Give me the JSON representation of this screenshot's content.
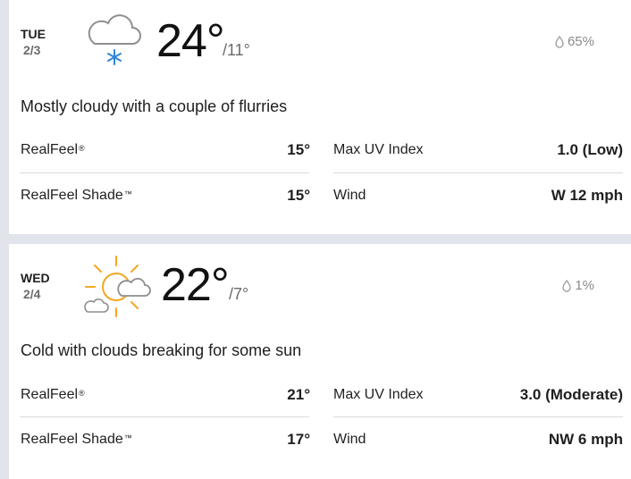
{
  "days": [
    {
      "day": "TUE",
      "date": "2/3",
      "icon": "cloudy-flurries-icon",
      "high": "24°",
      "low": "/11°",
      "precip": "65%",
      "phrase": "Mostly cloudy with a couple of flurries",
      "realfeel_label": "RealFeel",
      "realfeel": "15°",
      "realfeel_shade_label": "RealFeel Shade",
      "realfeel_shade": "15°",
      "uv_label": "Max UV Index",
      "uv": "1.0 (Low)",
      "wind_label": "Wind",
      "wind": "W 12 mph"
    },
    {
      "day": "WED",
      "date": "2/4",
      "icon": "partly-sunny-icon",
      "high": "22°",
      "low": "/7°",
      "precip": "1%",
      "phrase": "Cold with clouds breaking for some sun",
      "realfeel_label": "RealFeel",
      "realfeel": "21°",
      "realfeel_shade_label": "RealFeel Shade",
      "realfeel_shade": "17°",
      "uv_label": "Max UV Index",
      "uv": "3.0 (Moderate)",
      "wind_label": "Wind",
      "wind": "NW 6 mph"
    }
  ],
  "trademark": "®",
  "trademark_tm": "™",
  "colors": {
    "background": "#e1e5eb",
    "card": "#ffffff",
    "sun": "#f5a623",
    "snowflake": "#2e86de",
    "cloud_outline": "#8e8e8e"
  }
}
